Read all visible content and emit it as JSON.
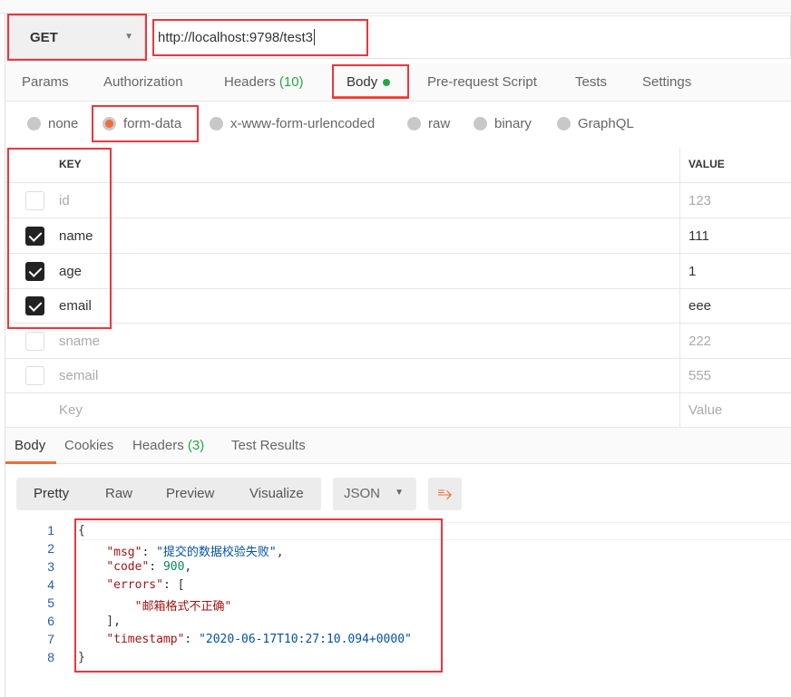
{
  "request": {
    "method": "GET",
    "url": "http://localhost:9798/test3"
  },
  "req_tabs": [
    {
      "label": "Params"
    },
    {
      "label": "Authorization"
    },
    {
      "label": "Headers",
      "count": "(10)"
    },
    {
      "label": "Body"
    },
    {
      "label": "Pre-request Script"
    },
    {
      "label": "Tests"
    },
    {
      "label": "Settings"
    }
  ],
  "body_types": [
    {
      "label": "none"
    },
    {
      "label": "form-data",
      "selected": true
    },
    {
      "label": "x-www-form-urlencoded"
    },
    {
      "label": "raw"
    },
    {
      "label": "binary"
    },
    {
      "label": "GraphQL"
    }
  ],
  "table": {
    "key_header": "KEY",
    "value_header": "VALUE",
    "rows": [
      {
        "key": "id",
        "value": "123",
        "checked": false
      },
      {
        "key": "name",
        "value": "111",
        "checked": true
      },
      {
        "key": "age",
        "value": "1",
        "checked": true
      },
      {
        "key": "email",
        "value": "eee",
        "checked": true
      },
      {
        "key": "sname",
        "value": "222",
        "checked": false
      },
      {
        "key": "semail",
        "value": "555",
        "checked": false
      }
    ],
    "placeholder_key": "Key",
    "placeholder_value": "Value"
  },
  "resp_tabs": [
    {
      "label": "Body"
    },
    {
      "label": "Cookies"
    },
    {
      "label": "Headers",
      "count": "(3)"
    },
    {
      "label": "Test Results"
    }
  ],
  "view_modes": [
    "Pretty",
    "Raw",
    "Preview",
    "Visualize"
  ],
  "format": "JSON",
  "line_numbers": [
    "1",
    "2",
    "3",
    "4",
    "5",
    "6",
    "7",
    "8"
  ],
  "response": {
    "msg_key": "\"msg\"",
    "msg": "\"提交的数据校验失败\"",
    "code_key": "\"code\"",
    "code": "900",
    "errors_key": "\"errors\"",
    "error0": "\"邮箱格式不正确\"",
    "timestamp_key": "\"timestamp\"",
    "timestamp": "\"2020-06-17T10:27:10.094+0000\""
  },
  "colors": {
    "accent": "#f26b3a",
    "green": "#26a745",
    "highlight": "#f0343c"
  }
}
